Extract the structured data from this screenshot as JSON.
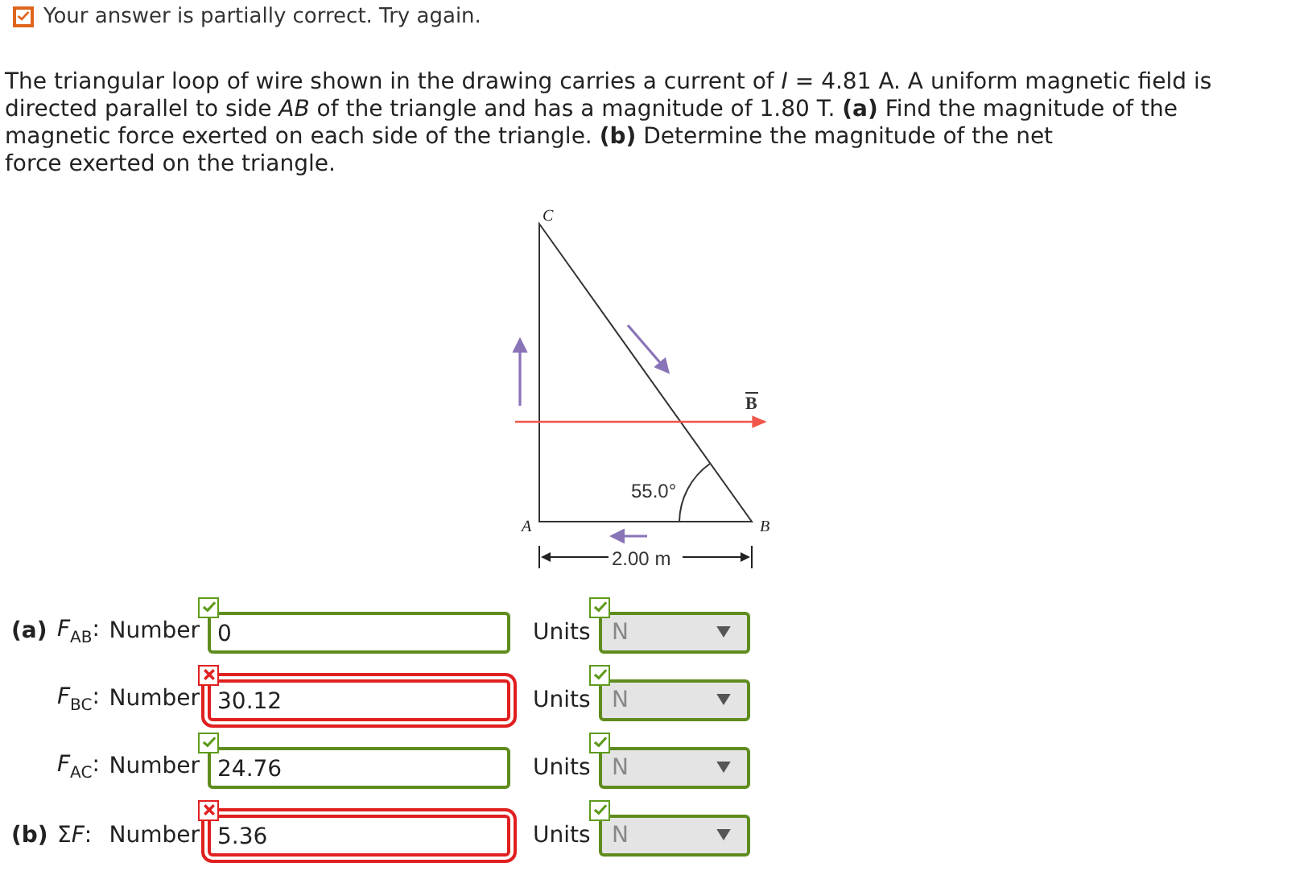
{
  "status_message": {
    "kind": "partial",
    "text": "Your answer is partially correct.  Try again."
  },
  "problem": "The triangular loop of wire shown in the drawing carries a current of *I* = 4.81 A. A uniform magnetic field is directed parallel to side *AB* of the triangle and has a magnitude of 1.80 T. **(a)** Find the magnitude of the magnetic force exerted on each side of the triangle. **(b)** Determine the magnitude of the net",
  "problem_continued": "force exerted on the triangle.",
  "figure": {
    "vertex_c": "C",
    "vertex_a": "A",
    "vertex_b": "B",
    "field_label": "B",
    "angle": "55.0°",
    "length": "2.00 m"
  },
  "answers": [
    {
      "part": "(a)",
      "variable": "*F*$_{AB}$:",
      "number_label": "Number",
      "value": "0",
      "correct": true,
      "units_label": "Units",
      "units": "N",
      "units_correct": true
    },
    {
      "variable": "*F*$_{BC}$:",
      "number_label": "Number",
      "value": "30.12",
      "correct": false,
      "units_label": "Units",
      "units": "N",
      "units_correct": true
    },
    {
      "variable": "*F*$_{AC}$:",
      "number_label": "Number",
      "value": "24.76",
      "correct": true,
      "units_label": "Units",
      "units": "N",
      "units_correct": true
    },
    {
      "part": "(b)",
      "variable_prefix": "Σ",
      "variable": "*F*:",
      "number_label": "Number",
      "value": "5.36",
      "correct": false,
      "units_label": "Units",
      "units": "N",
      "units_correct": true
    }
  ]
}
